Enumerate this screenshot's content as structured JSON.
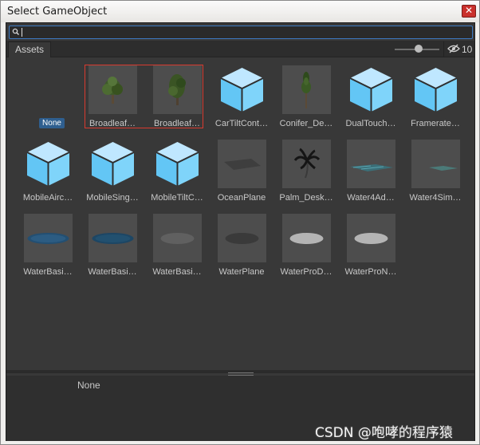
{
  "window": {
    "title": "Select GameObject",
    "close_glyph": "✕"
  },
  "search": {
    "value": ""
  },
  "tab": {
    "assets_label": "Assets"
  },
  "toolbar": {
    "thumbnail_size": 0.55,
    "hidden_count": "10"
  },
  "items": [
    {
      "label": "None",
      "kind": "none"
    },
    {
      "label": "Broadleaf…",
      "kind": "tree-broad",
      "selected": true
    },
    {
      "label": "Broadleaf…",
      "kind": "tree-broad2",
      "selected": true
    },
    {
      "label": "CarTiltCont…",
      "kind": "cube"
    },
    {
      "label": "Conifer_De…",
      "kind": "tree-conifer"
    },
    {
      "label": "DualTouch…",
      "kind": "cube"
    },
    {
      "label": "Framerate…",
      "kind": "cube"
    },
    {
      "label": "MobileAirc…",
      "kind": "cube"
    },
    {
      "label": "MobileSing…",
      "kind": "cube"
    },
    {
      "label": "MobileTiltC…",
      "kind": "cube"
    },
    {
      "label": "OceanPlane",
      "kind": "plane"
    },
    {
      "label": "Palm_Desk…",
      "kind": "palm"
    },
    {
      "label": "Water4Ad…",
      "kind": "water4a"
    },
    {
      "label": "Water4Sim…",
      "kind": "water4s"
    },
    {
      "label": "WaterBasi…",
      "kind": "disc-blue"
    },
    {
      "label": "WaterBasi…",
      "kind": "disc-darkblue"
    },
    {
      "label": "WaterBasi…",
      "kind": "disc-grey"
    },
    {
      "label": "WaterPlane",
      "kind": "disc-dark"
    },
    {
      "label": "WaterProD…",
      "kind": "disc-light"
    },
    {
      "label": "WaterProN…",
      "kind": "disc-light"
    }
  ],
  "detail": {
    "text": "None"
  },
  "watermark": "CSDN @咆哮的程序猿"
}
